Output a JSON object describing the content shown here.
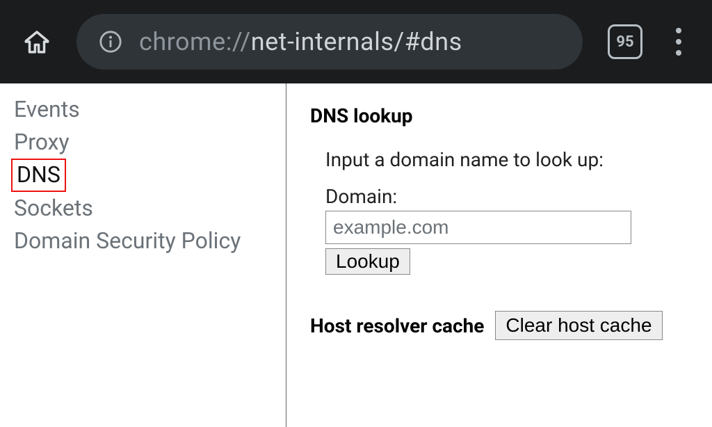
{
  "toolbar": {
    "url_scheme": "chrome://",
    "url_path": "net-internals/#dns",
    "tab_count": "95"
  },
  "sidebar": {
    "items": [
      {
        "label": "Events"
      },
      {
        "label": "Proxy"
      },
      {
        "label": "DNS"
      },
      {
        "label": "Sockets"
      },
      {
        "label": "Domain Security Policy"
      }
    ],
    "selected_index": 2
  },
  "main": {
    "section_title": "DNS lookup",
    "prompt": "Input a domain name to look up:",
    "domain_label": "Domain:",
    "domain_placeholder": "example.com",
    "domain_value": "",
    "lookup_label": "Lookup",
    "cache_title": "Host resolver cache",
    "clear_cache_label": "Clear host cache"
  }
}
